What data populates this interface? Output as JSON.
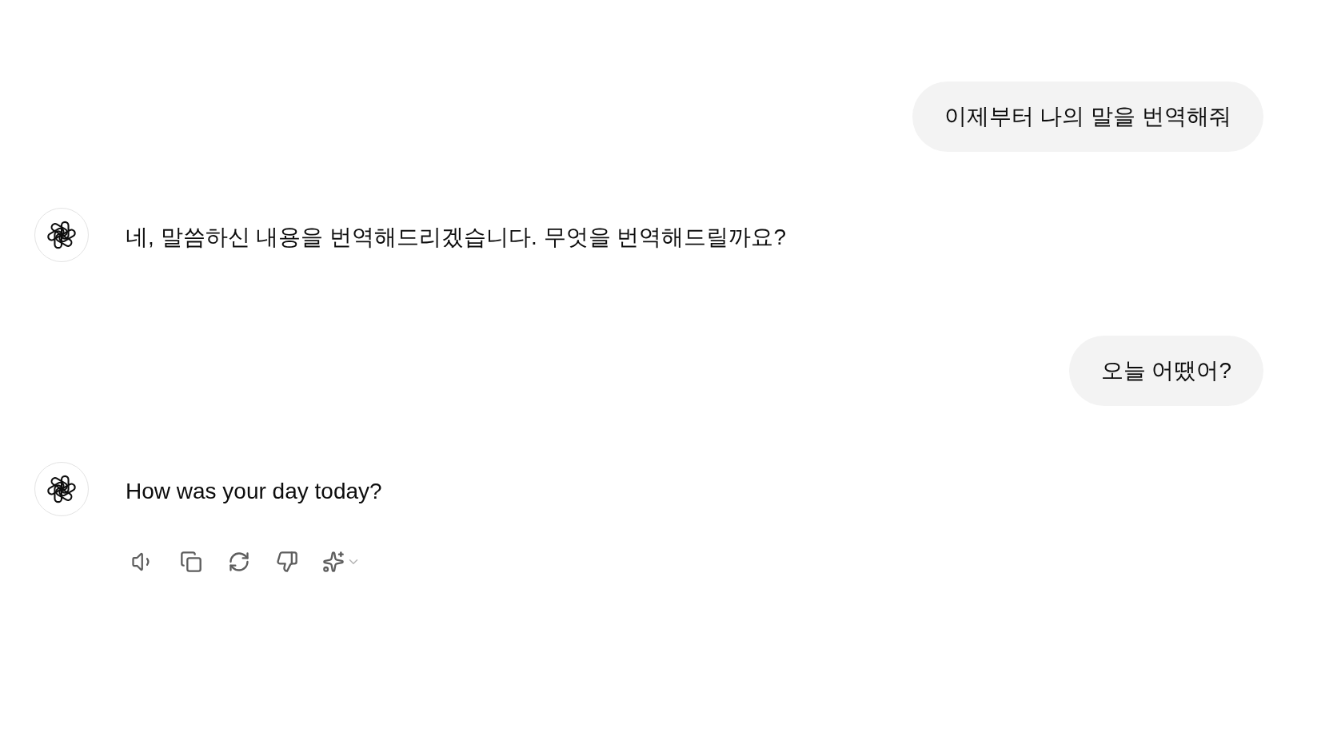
{
  "messages": [
    {
      "kind": "user",
      "text": "이제부터 나의 말을 번역해줘"
    },
    {
      "kind": "assistant",
      "text": "네, 말씀하신 내용을 번역해드리겠습니다. 무엇을 번역해드릴까요?"
    },
    {
      "kind": "user",
      "text": "오늘 어땠어?"
    },
    {
      "kind": "assistant",
      "text": "How was your day today?"
    }
  ]
}
